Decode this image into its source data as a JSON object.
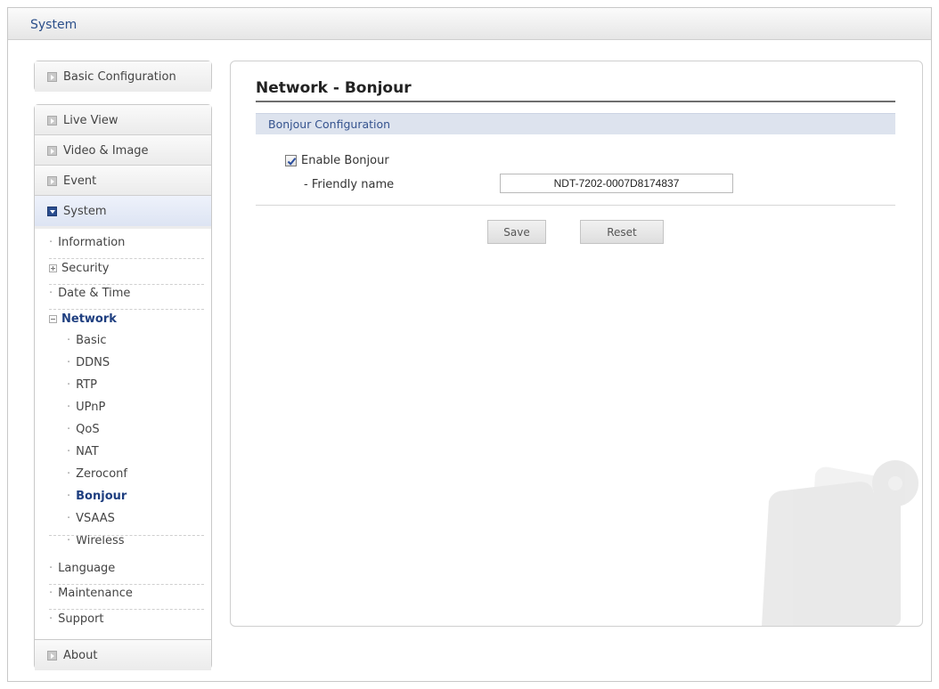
{
  "header": {
    "title": "System"
  },
  "sidebar": {
    "basic": "Basic Configuration",
    "menu": [
      "Live View",
      "Video & Image",
      "Event",
      "System"
    ],
    "system_items": {
      "information": "Information",
      "security": "Security",
      "date_time": "Date & Time",
      "network": "Network",
      "network_items": [
        "Basic",
        "DDNS",
        "RTP",
        "UPnP",
        "QoS",
        "NAT",
        "Zeroconf",
        "Bonjour",
        "VSAAS",
        "Wireless"
      ],
      "language": "Language",
      "maintenance": "Maintenance",
      "support": "Support"
    },
    "about": "About"
  },
  "main": {
    "heading": "Network - Bonjour",
    "section": "Bonjour Configuration",
    "enable_label": "Enable Bonjour",
    "enable_checked": true,
    "friendly_label": "- Friendly name",
    "friendly_value": "NDT-7202-0007D8174837",
    "save_label": "Save",
    "reset_label": "Reset"
  }
}
